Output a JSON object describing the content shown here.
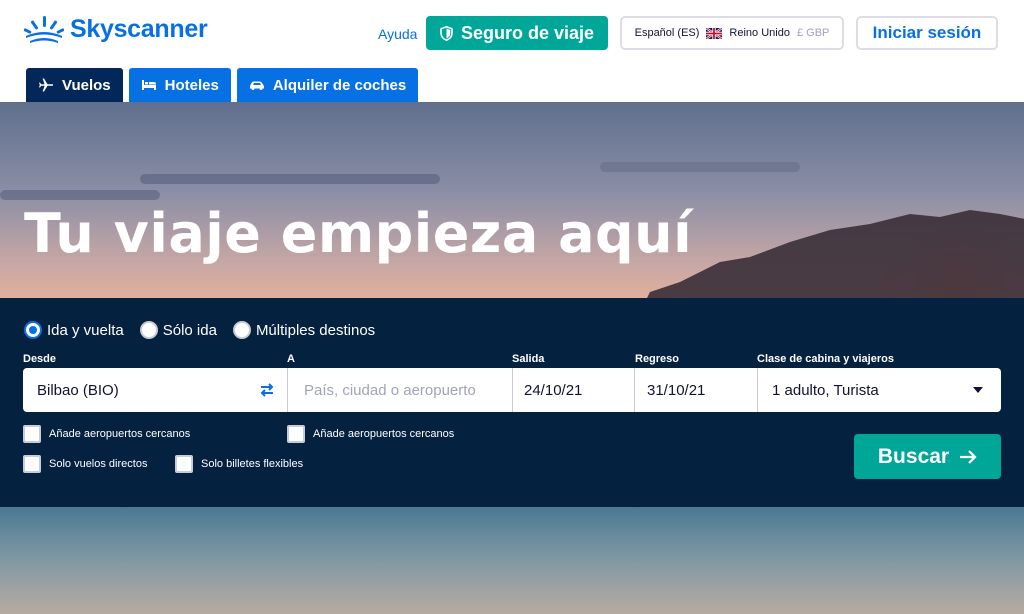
{
  "brand": {
    "name": "Skyscanner",
    "color": "#0770e3",
    "icon": "sunburst-logo-icon"
  },
  "header": {
    "help": "Ayuda",
    "insurance_label": "Seguro de viaje",
    "insurance_icon": "shield-icon",
    "locale": {
      "language": "Español (ES)",
      "flag_icon": "uk-flag-icon",
      "country": "Reino Unido",
      "currency": "£ GBP"
    },
    "login": "Iniciar sesión"
  },
  "tabs": [
    {
      "label": "Vuelos",
      "icon": "plane-icon",
      "active": true
    },
    {
      "label": "Hoteles",
      "icon": "bed-icon",
      "active": false
    },
    {
      "label": "Alquiler de coches",
      "icon": "car-icon",
      "active": false
    }
  ],
  "hero": {
    "title": "Tu viaje empieza aquí"
  },
  "search": {
    "trip_types": [
      {
        "label": "Ida y vuelta",
        "selected": true
      },
      {
        "label": "Sólo ida",
        "selected": false
      },
      {
        "label": "Múltiples destinos",
        "selected": false
      }
    ],
    "from": {
      "label": "Desde",
      "value": "Bilbao (BIO)"
    },
    "to": {
      "label": "A",
      "placeholder": "País, ciudad o aeropuerto"
    },
    "depart": {
      "label": "Salida",
      "value": "24/10/21"
    },
    "return": {
      "label": "Regreso",
      "value": "31/10/21"
    },
    "cabin": {
      "label": "Clase de cabina y viajeros",
      "value": "1 adulto, Turista"
    },
    "options": {
      "nearby_from": "Añade aeropuertos cercanos",
      "nearby_to": "Añade aeropuertos cercanos",
      "direct_only": "Solo vuelos directos",
      "flexible_tickets": "Solo billetes flexibles"
    },
    "submit": "Buscar"
  },
  "colors": {
    "accent": "#00a698",
    "panel": "#04213f",
    "active_tab": "#042759"
  }
}
